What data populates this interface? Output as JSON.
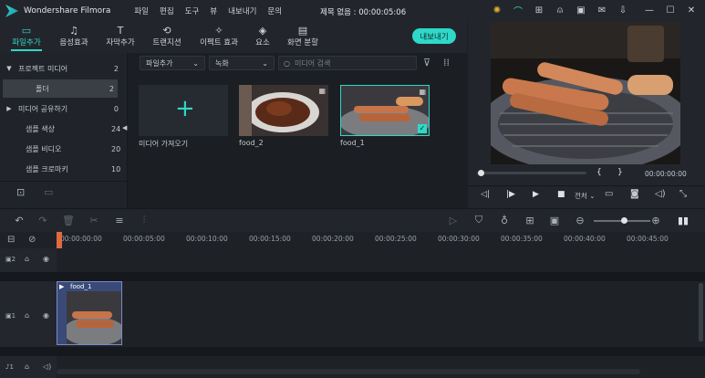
{
  "app": {
    "name": "Wondershare Filmora",
    "menu": [
      "파일",
      "편집",
      "도구",
      "뷰",
      "내보내기",
      "문의"
    ],
    "doc_title": "제목 없음 : 00:00:05:06",
    "titlebar_icons": [
      "bulb-icon",
      "headset-icon",
      "gift-icon",
      "user-icon",
      "save-icon",
      "mail-icon",
      "download-icon",
      "minimize-icon",
      "maximize-icon",
      "close-icon"
    ]
  },
  "tabs": [
    {
      "label": "파일추가",
      "icon": "folder-icon",
      "active": true
    },
    {
      "label": "음성효과",
      "icon": "music-icon",
      "active": false
    },
    {
      "label": "자막추가",
      "icon": "text-icon",
      "active": false
    },
    {
      "label": "트랜지션",
      "icon": "transition-icon",
      "active": false
    },
    {
      "label": "이펙트 효과",
      "icon": "effect-icon",
      "active": false
    },
    {
      "label": "요소",
      "icon": "element-icon",
      "active": false
    },
    {
      "label": "화면 분할",
      "icon": "split-icon",
      "active": false
    }
  ],
  "export_label": "내보내기",
  "sidebar": {
    "items": [
      {
        "label": "프로젝트 미디어",
        "count": "2",
        "arrow": "▼"
      },
      {
        "label": "폴더",
        "count": "2",
        "arrow": ""
      },
      {
        "label": "미디어 공유하기",
        "count": "0",
        "arrow": "▶"
      },
      {
        "label": "샘플 색상",
        "count": "24",
        "arrow": ""
      },
      {
        "label": "샘플 비디오",
        "count": "20",
        "arrow": ""
      },
      {
        "label": "샘플 크로마키",
        "count": "10",
        "arrow": ""
      }
    ]
  },
  "media": {
    "filter1": "파일추가",
    "filter2": "녹화",
    "search_placeholder": "미디어 검색",
    "import_label": "미디어 가져오기",
    "items": [
      {
        "name": "food_2"
      },
      {
        "name": "food_1",
        "selected": true
      }
    ]
  },
  "player": {
    "bracket_in": "{",
    "bracket_out": "}",
    "timecode": "00:00:00:00",
    "quality": "전처"
  },
  "timeline": {
    "ticks": [
      "00:00:00:00",
      "00:00:05:00",
      "00:00:10:00",
      "00:00:15:00",
      "00:00:20:00",
      "00:00:25:00",
      "00:00:30:00",
      "00:00:35:00",
      "00:00:40:00",
      "00:00:45:00"
    ],
    "clip_name": "food_1",
    "track_labels": [
      "2",
      "1",
      "1"
    ]
  },
  "colors": {
    "accent": "#2fd8c8"
  }
}
